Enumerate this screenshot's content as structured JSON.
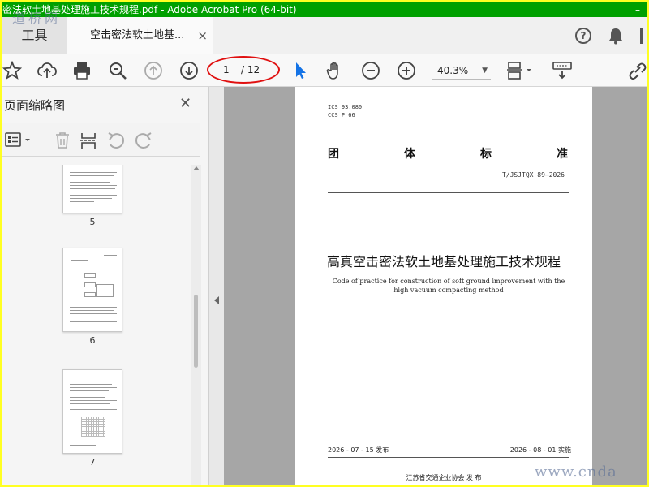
{
  "window": {
    "title": "密法软土地基处理施工技术规程.pdf - Adobe Acrobat Pro (64-bit)",
    "minimize_label": "–"
  },
  "watermarks": {
    "top_left": "道桥网",
    "bottom_right": "www.cnda"
  },
  "tabs": {
    "tools_label": "工具",
    "document_label": "空击密法软土地基...",
    "close_glyph": "×"
  },
  "toolbar": {
    "page_current": "1",
    "page_total": "/ 12",
    "zoom_value": "40.3%",
    "zoom_dropdown": "▼"
  },
  "left_panel": {
    "title": "页面缩略图",
    "close_glyph": "✕",
    "thumbnails": [
      {
        "label": "5"
      },
      {
        "label": "6"
      },
      {
        "label": "7"
      }
    ]
  },
  "document_page": {
    "ics_line": "ICS  93.080",
    "ccs_line": "CCS  P 66",
    "standard_type": [
      "团",
      "体",
      "标",
      "准"
    ],
    "doc_number": "T/JSJTQX 89—2026",
    "title_cn": "高真空击密法软土地基处理施工技术规程",
    "title_en": "Code of practice for construction of soft ground improvement with the high vacuum compacting method",
    "publish_date": "2026 - 07 - 15 发布",
    "effective_date": "2026 - 08 - 01 实施",
    "issuer": "江苏省交通企业协会     发  布"
  }
}
